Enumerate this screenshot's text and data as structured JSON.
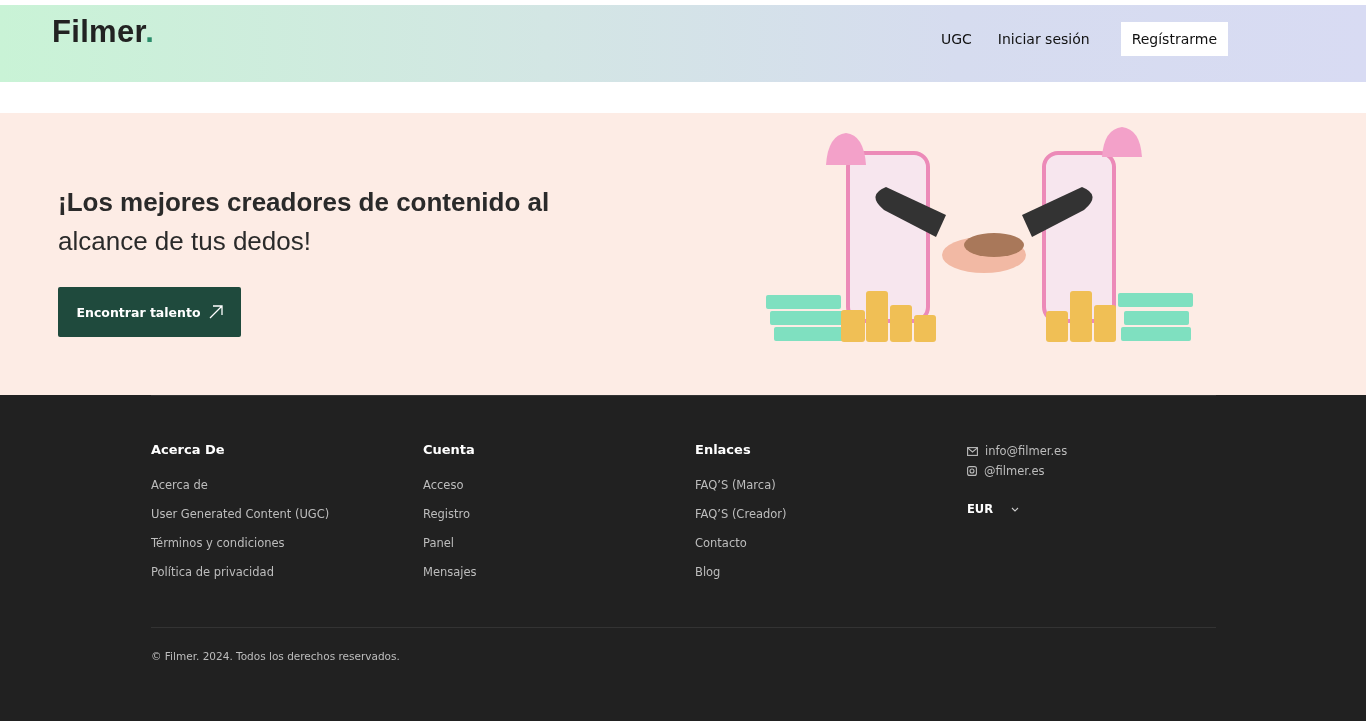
{
  "header": {
    "logo": "Filmer.",
    "nav": [
      "UGC",
      "Iniciar sesión"
    ],
    "register_button": "Regístrarme"
  },
  "hero": {
    "heading": "**¡Los mejores creadores de contenido al** alcance de tus dedos!",
    "cta": "Encontrar talento"
  },
  "footer": {
    "columns": [
      {
        "title": "Acerca De",
        "links": [
          "Acerca de",
          "User Generated Content (UGC)",
          "Términos y condiciones",
          "Política de privacidad"
        ]
      },
      {
        "title": "Cuenta",
        "links": [
          "Acceso",
          "Registro",
          "Panel",
          "Mensajes"
        ]
      },
      {
        "title": "Enlaces",
        "links": [
          "FAQ’S (Marca)",
          "FAQ’S (Creador)",
          "Contacto",
          "Blog"
        ]
      }
    ],
    "contacts": [
      {
        "kind": "email",
        "text": "info@filmer.es"
      },
      {
        "kind": "instagram",
        "text": "@filmer.es"
      }
    ],
    "currency": "EUR",
    "copyright": "© Filmer. 2024. Todos los derechos reservados."
  }
}
